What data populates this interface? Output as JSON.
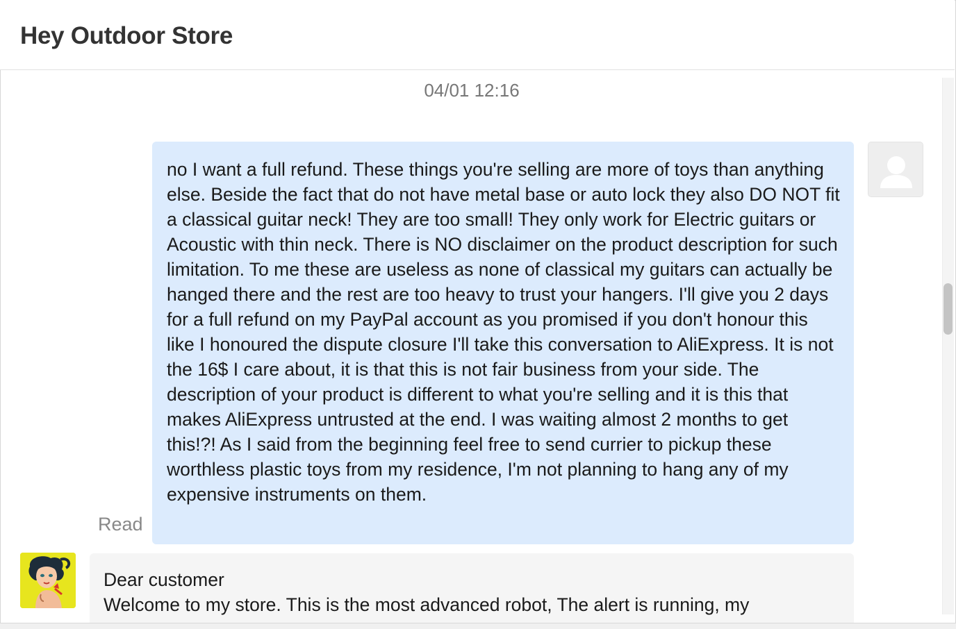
{
  "header": {
    "title": "Hey Outdoor Store"
  },
  "conversation": {
    "timestamp": "04/01 12:16",
    "outgoing": {
      "text": "no I want a full refund. These things you're selling are more of toys than anything else. Beside the fact that do not have metal base or auto lock they also DO NOT fit a classical guitar neck! They are too small! They only work for Electric guitars or Acoustic with thin neck. There is NO disclaimer on the product description for such limitation. To me these are useless as none of classical my guitars can actually be hanged there and the rest are too heavy to trust your hangers. I'll give you 2 days for a full refund on my PayPal account as you promised if you don't honour this like I honoured the dispute closure I'll take this conversation to AliExpress. It is not the 16$ I care about, it is that this is not fair business from your side. The description of your product is different to what you're selling and it is this that makes AliExpress untrusted at the end. I was waiting almost 2 months to get this!?! As I said from the beginning feel free to send currier to pickup these worthless plastic toys from my residence, I'm not planning to hang any of my expensive instruments on them.",
      "status": "Read",
      "avatar_icon": "user-placeholder-icon"
    },
    "incoming": {
      "greeting": "Dear customer",
      "line1": "Welcome to my store. This is the most advanced robot, The alert is running, my",
      "avatar_icon": "store-avatar-icon"
    }
  },
  "colors": {
    "outgoing_bubble": "#dcebfd",
    "incoming_bubble": "#f5f5f5",
    "title_text": "#333333",
    "muted_text": "#777777"
  }
}
